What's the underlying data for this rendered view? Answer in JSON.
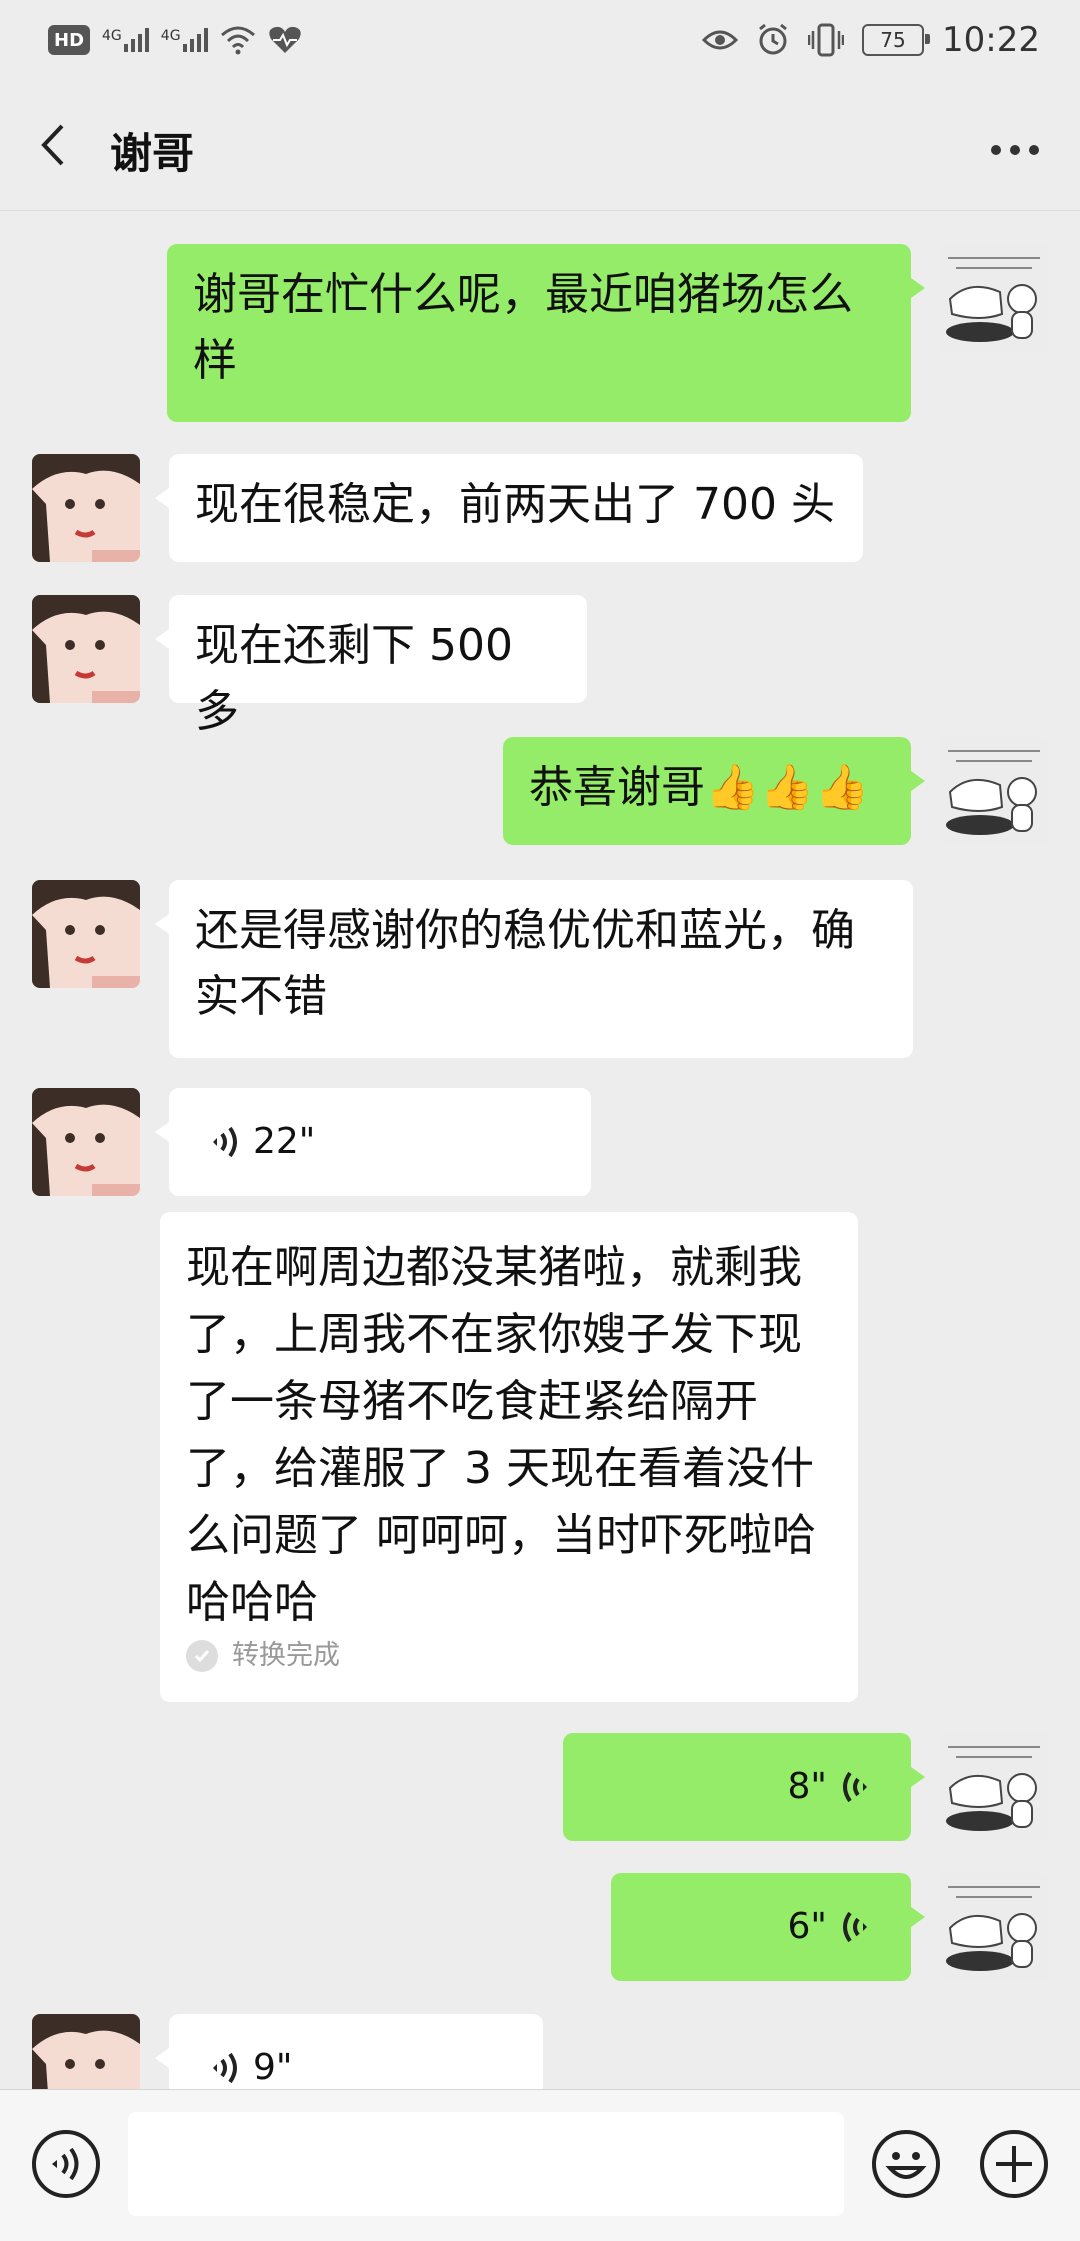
{
  "status_bar": {
    "left_icons": [
      "hd-icon",
      "signal-4g-icon",
      "signal-4g-icon",
      "wifi-icon",
      "heart-rate-icon"
    ],
    "hd_label": "HD",
    "net_label_1": "4G",
    "net_label_2": "4G",
    "battery": "75",
    "time": "10:22",
    "right_icons": [
      "eye-icon",
      "alarm-icon",
      "vibrate-icon",
      "battery-icon"
    ]
  },
  "header": {
    "title": "谢哥",
    "back_icon": "back-chevron-icon",
    "more_icon": "more-dots-icon"
  },
  "messages": [
    {
      "from": "me",
      "type": "text",
      "text": "谢哥在忙什么呢，最近咱猪场怎么样"
    },
    {
      "from": "her",
      "type": "text",
      "text": "现在很稳定，前两天出了 700 头"
    },
    {
      "from": "her",
      "type": "text",
      "text": "现在还剩下 500 多"
    },
    {
      "from": "me",
      "type": "text",
      "text": "恭喜谢哥",
      "emoji": "👍👍👍"
    },
    {
      "from": "her",
      "type": "text",
      "text": "还是得感谢你的稳优优和蓝光，确实不错"
    },
    {
      "from": "her",
      "type": "voice",
      "duration": "22\""
    },
    {
      "from": "her",
      "type": "transcript",
      "text": "现在啊周边都没某猪啦，就剩我了，上周我不在家你嫂子发下现了一条母猪不吃食赶紧给隔开了，给灌服了 3 天现在看着没什么问题了 呵呵呵，当时吓死啦哈哈哈哈",
      "status": "转换完成"
    },
    {
      "from": "me",
      "type": "voice",
      "duration": "8\""
    },
    {
      "from": "me",
      "type": "voice",
      "duration": "6\""
    },
    {
      "from": "her",
      "type": "voice",
      "duration": "9\""
    }
  ],
  "input_bar": {
    "voice_icon": "voice-input-icon",
    "input_value": "",
    "emoji_icon": "emoji-icon",
    "plus_icon": "plus-icon"
  },
  "colors": {
    "my_bubble": "#95ec69",
    "her_bubble": "#ffffff",
    "background": "#ededed"
  }
}
